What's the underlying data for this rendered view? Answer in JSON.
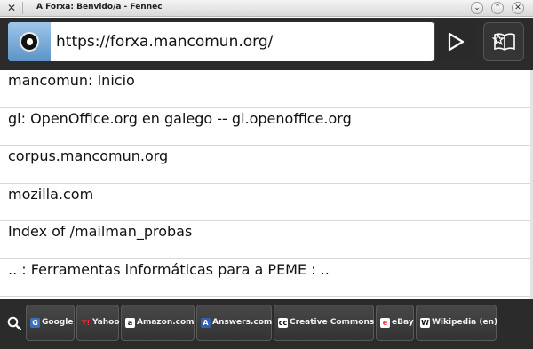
{
  "window": {
    "title": "A Forxa: Benvido/a - Fennec",
    "min_glyph": "⌄",
    "max_glyph": "⌃",
    "close_glyph": "✕"
  },
  "toolbar": {
    "url": "https://forxa.mancomun.org/"
  },
  "awesome_list": [
    {
      "label": "mancomun: Inicio"
    },
    {
      "label": "gl: OpenOffice.org en galego -- gl.openoffice.org"
    },
    {
      "label": "corpus.mancomun.org"
    },
    {
      "label": "mozilla.com"
    },
    {
      "label": "Index of /mailman_probas"
    },
    {
      "label": ".. : Ferramentas informáticas para a PEME : .."
    }
  ],
  "search_engines": [
    {
      "label": "Google",
      "icon": "G",
      "icon_name": "google-icon",
      "icon_color": "#ffffff",
      "icon_bg": "#3b6dc1"
    },
    {
      "label": "Yahoo",
      "icon": "Y!",
      "icon_name": "yahoo-icon",
      "icon_color": "#ff2a2a",
      "icon_bg": "transparent"
    },
    {
      "label": "Amazon.com",
      "icon": "a",
      "icon_name": "amazon-icon",
      "icon_color": "#111111",
      "icon_bg": "#ffffff"
    },
    {
      "label": "Answers.com",
      "icon": "A",
      "icon_name": "answers-icon",
      "icon_color": "#ffffff",
      "icon_bg": "#2f62b3"
    },
    {
      "label": "Creative Commons",
      "icon": "cc",
      "icon_name": "creative-commons-icon",
      "icon_color": "#111111",
      "icon_bg": "#ffffff"
    },
    {
      "label": "eBay",
      "icon": "e",
      "icon_name": "ebay-icon",
      "icon_color": "#e53238",
      "icon_bg": "#ffffff"
    },
    {
      "label": "Wikipedia (en)",
      "icon": "W",
      "icon_name": "wikipedia-icon",
      "icon_color": "#111111",
      "icon_bg": "#ffffff"
    }
  ],
  "colors": {
    "chrome_dark": "#2b2b2b",
    "url_background": "#ffffff",
    "site_icon_blue": "#7aaedb"
  }
}
